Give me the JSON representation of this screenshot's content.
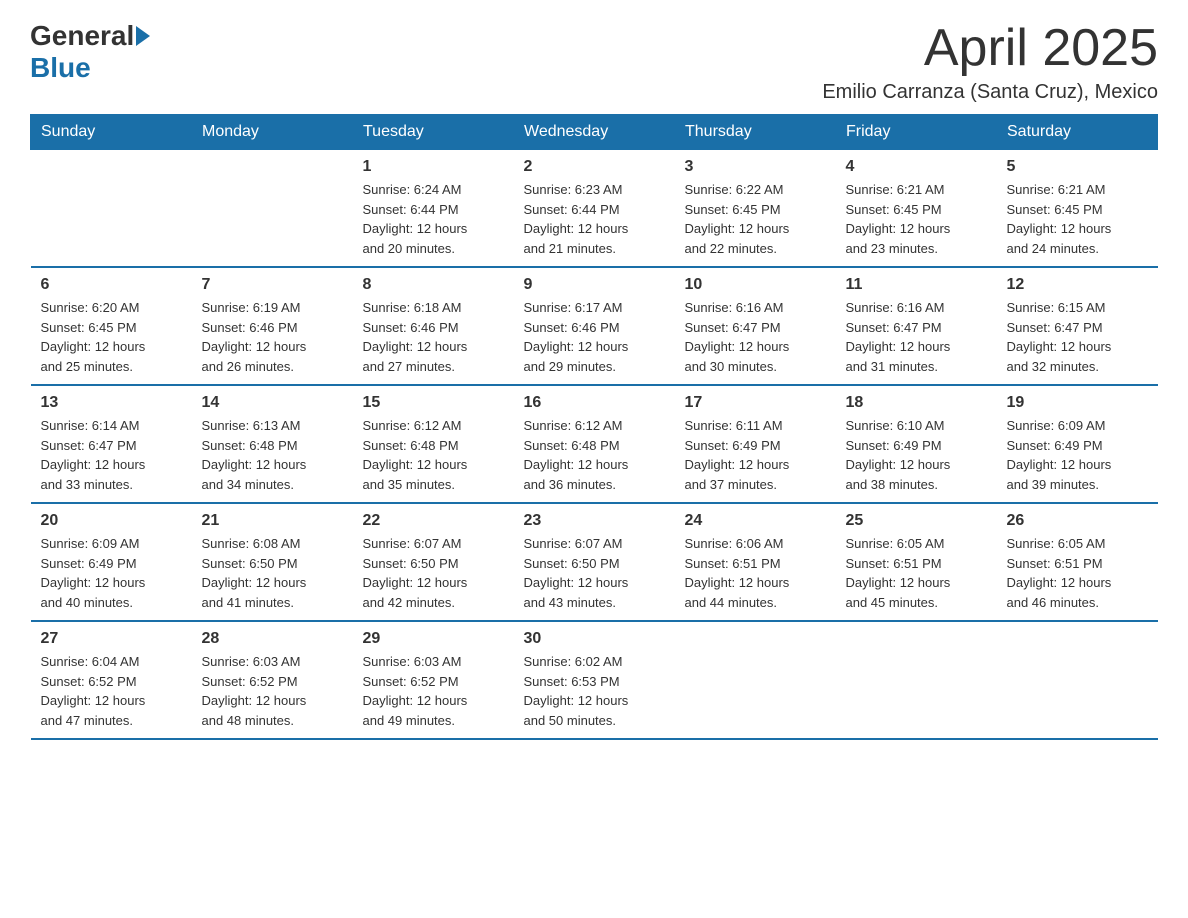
{
  "header": {
    "logo_general": "General",
    "logo_blue": "Blue",
    "title": "April 2025",
    "subtitle": "Emilio Carranza (Santa Cruz), Mexico"
  },
  "calendar": {
    "weekdays": [
      "Sunday",
      "Monday",
      "Tuesday",
      "Wednesday",
      "Thursday",
      "Friday",
      "Saturday"
    ],
    "weeks": [
      [
        {
          "day": "",
          "info": ""
        },
        {
          "day": "",
          "info": ""
        },
        {
          "day": "1",
          "info": "Sunrise: 6:24 AM\nSunset: 6:44 PM\nDaylight: 12 hours\nand 20 minutes."
        },
        {
          "day": "2",
          "info": "Sunrise: 6:23 AM\nSunset: 6:44 PM\nDaylight: 12 hours\nand 21 minutes."
        },
        {
          "day": "3",
          "info": "Sunrise: 6:22 AM\nSunset: 6:45 PM\nDaylight: 12 hours\nand 22 minutes."
        },
        {
          "day": "4",
          "info": "Sunrise: 6:21 AM\nSunset: 6:45 PM\nDaylight: 12 hours\nand 23 minutes."
        },
        {
          "day": "5",
          "info": "Sunrise: 6:21 AM\nSunset: 6:45 PM\nDaylight: 12 hours\nand 24 minutes."
        }
      ],
      [
        {
          "day": "6",
          "info": "Sunrise: 6:20 AM\nSunset: 6:45 PM\nDaylight: 12 hours\nand 25 minutes."
        },
        {
          "day": "7",
          "info": "Sunrise: 6:19 AM\nSunset: 6:46 PM\nDaylight: 12 hours\nand 26 minutes."
        },
        {
          "day": "8",
          "info": "Sunrise: 6:18 AM\nSunset: 6:46 PM\nDaylight: 12 hours\nand 27 minutes."
        },
        {
          "day": "9",
          "info": "Sunrise: 6:17 AM\nSunset: 6:46 PM\nDaylight: 12 hours\nand 29 minutes."
        },
        {
          "day": "10",
          "info": "Sunrise: 6:16 AM\nSunset: 6:47 PM\nDaylight: 12 hours\nand 30 minutes."
        },
        {
          "day": "11",
          "info": "Sunrise: 6:16 AM\nSunset: 6:47 PM\nDaylight: 12 hours\nand 31 minutes."
        },
        {
          "day": "12",
          "info": "Sunrise: 6:15 AM\nSunset: 6:47 PM\nDaylight: 12 hours\nand 32 minutes."
        }
      ],
      [
        {
          "day": "13",
          "info": "Sunrise: 6:14 AM\nSunset: 6:47 PM\nDaylight: 12 hours\nand 33 minutes."
        },
        {
          "day": "14",
          "info": "Sunrise: 6:13 AM\nSunset: 6:48 PM\nDaylight: 12 hours\nand 34 minutes."
        },
        {
          "day": "15",
          "info": "Sunrise: 6:12 AM\nSunset: 6:48 PM\nDaylight: 12 hours\nand 35 minutes."
        },
        {
          "day": "16",
          "info": "Sunrise: 6:12 AM\nSunset: 6:48 PM\nDaylight: 12 hours\nand 36 minutes."
        },
        {
          "day": "17",
          "info": "Sunrise: 6:11 AM\nSunset: 6:49 PM\nDaylight: 12 hours\nand 37 minutes."
        },
        {
          "day": "18",
          "info": "Sunrise: 6:10 AM\nSunset: 6:49 PM\nDaylight: 12 hours\nand 38 minutes."
        },
        {
          "day": "19",
          "info": "Sunrise: 6:09 AM\nSunset: 6:49 PM\nDaylight: 12 hours\nand 39 minutes."
        }
      ],
      [
        {
          "day": "20",
          "info": "Sunrise: 6:09 AM\nSunset: 6:49 PM\nDaylight: 12 hours\nand 40 minutes."
        },
        {
          "day": "21",
          "info": "Sunrise: 6:08 AM\nSunset: 6:50 PM\nDaylight: 12 hours\nand 41 minutes."
        },
        {
          "day": "22",
          "info": "Sunrise: 6:07 AM\nSunset: 6:50 PM\nDaylight: 12 hours\nand 42 minutes."
        },
        {
          "day": "23",
          "info": "Sunrise: 6:07 AM\nSunset: 6:50 PM\nDaylight: 12 hours\nand 43 minutes."
        },
        {
          "day": "24",
          "info": "Sunrise: 6:06 AM\nSunset: 6:51 PM\nDaylight: 12 hours\nand 44 minutes."
        },
        {
          "day": "25",
          "info": "Sunrise: 6:05 AM\nSunset: 6:51 PM\nDaylight: 12 hours\nand 45 minutes."
        },
        {
          "day": "26",
          "info": "Sunrise: 6:05 AM\nSunset: 6:51 PM\nDaylight: 12 hours\nand 46 minutes."
        }
      ],
      [
        {
          "day": "27",
          "info": "Sunrise: 6:04 AM\nSunset: 6:52 PM\nDaylight: 12 hours\nand 47 minutes."
        },
        {
          "day": "28",
          "info": "Sunrise: 6:03 AM\nSunset: 6:52 PM\nDaylight: 12 hours\nand 48 minutes."
        },
        {
          "day": "29",
          "info": "Sunrise: 6:03 AM\nSunset: 6:52 PM\nDaylight: 12 hours\nand 49 minutes."
        },
        {
          "day": "30",
          "info": "Sunrise: 6:02 AM\nSunset: 6:53 PM\nDaylight: 12 hours\nand 50 minutes."
        },
        {
          "day": "",
          "info": ""
        },
        {
          "day": "",
          "info": ""
        },
        {
          "day": "",
          "info": ""
        }
      ]
    ]
  }
}
